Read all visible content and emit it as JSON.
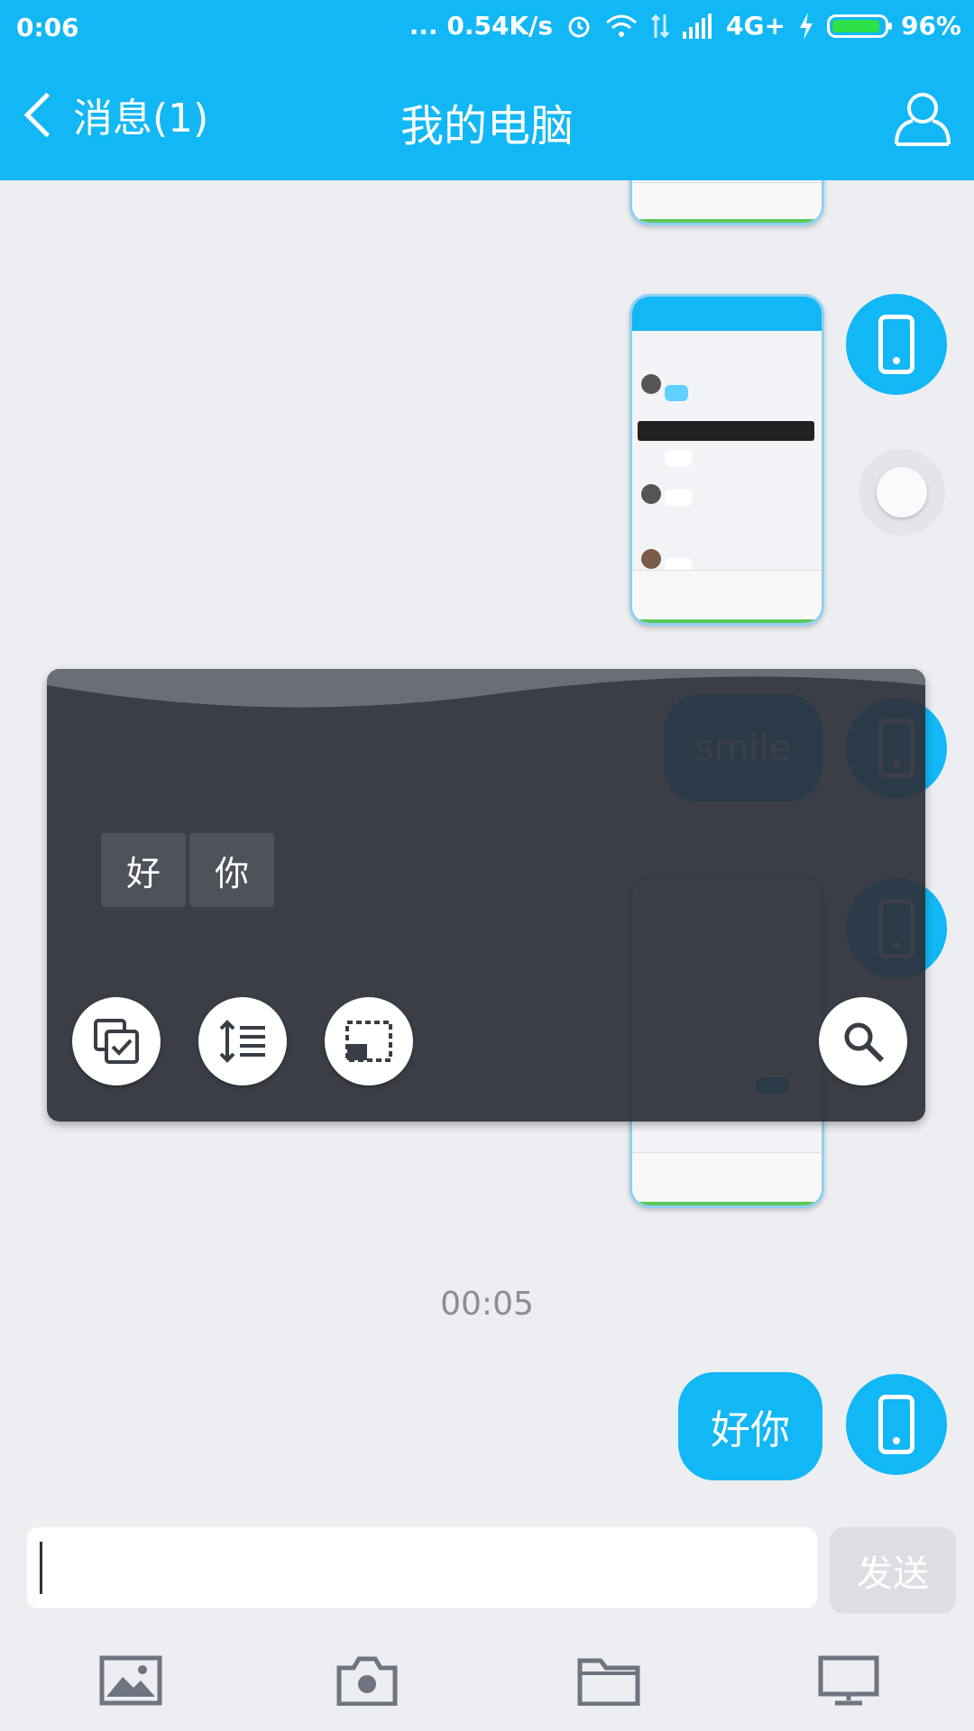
{
  "status_bar": {
    "time": "0:06",
    "speed": "... 0.54K/s",
    "network": "4G+",
    "battery": "96%"
  },
  "header": {
    "back_label": "消息(1)",
    "title": "我的电脑",
    "accent": "#12b7f5"
  },
  "chat": {
    "overlay_words": [
      "好",
      "你"
    ],
    "ghost_bubble": "smile",
    "timestamp": "00:05",
    "last_message": "好你"
  },
  "input": {
    "value": "",
    "send_label": "发送"
  },
  "bottom_bar": {
    "icons": [
      "image-icon",
      "camera-icon",
      "folder-icon",
      "computer-icon"
    ]
  },
  "overlay_tools": [
    "copy-select-icon",
    "line-spacing-icon",
    "fullscreen-crop-icon",
    "search-icon"
  ]
}
